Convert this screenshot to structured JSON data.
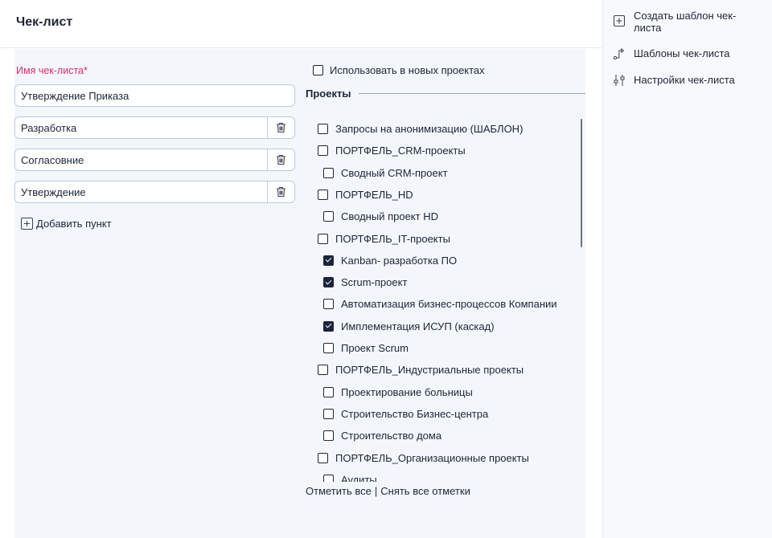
{
  "header": {
    "title": "Чек-лист"
  },
  "form": {
    "name_label": "Имя чек-листа*",
    "name_value": "Утверждение Приказа",
    "items": [
      "Разработка",
      "Согласовние",
      "Утверждение"
    ],
    "add_item_label": "Добавить пункт"
  },
  "use_in_new_projects": {
    "label": "Использовать в новых проектах",
    "checked": false
  },
  "projects": {
    "title": "Проекты",
    "items": [
      {
        "label": "Запросы на анонимизацию (ШАБЛОН)",
        "level": 0,
        "checked": false
      },
      {
        "label": "ПОРТФЕЛЬ_CRM-проекты",
        "level": 0,
        "checked": false
      },
      {
        "label": "Сводный CRM-проект",
        "level": 1,
        "checked": false
      },
      {
        "label": "ПОРТФЕЛЬ_HD",
        "level": 0,
        "checked": false
      },
      {
        "label": "Сводный проект HD",
        "level": 1,
        "checked": false
      },
      {
        "label": "ПОРТФЕЛЬ_IT-проекты",
        "level": 0,
        "checked": false
      },
      {
        "label": "Kanban- разработка ПО",
        "level": 1,
        "checked": true
      },
      {
        "label": "Scrum-проект",
        "level": 1,
        "checked": true
      },
      {
        "label": "Автоматизация бизнес-процессов Компании",
        "level": 1,
        "checked": false
      },
      {
        "label": "Имплементация ИСУП (каскад)",
        "level": 1,
        "checked": true
      },
      {
        "label": "Проект Scrum",
        "level": 1,
        "checked": false
      },
      {
        "label": "ПОРТФЕЛЬ_Индустриальные проекты",
        "level": 0,
        "checked": false
      },
      {
        "label": "Проектирование больницы",
        "level": 1,
        "checked": false
      },
      {
        "label": "Строительство Бизнес-центра",
        "level": 1,
        "checked": false
      },
      {
        "label": "Строительство дома",
        "level": 1,
        "checked": false
      },
      {
        "label": "ПОРТФЕЛЬ_Организационные проекты",
        "level": 0,
        "checked": false
      },
      {
        "label": "Аудиты",
        "level": 1,
        "checked": false
      }
    ],
    "select_all": "Отметить все",
    "separator": "|",
    "deselect_all": "Снять все отметки"
  },
  "sidebar": {
    "items": [
      {
        "label": "Создать шаблон чек-листа",
        "icon": "plus-square-icon"
      },
      {
        "label": "Шаблоны чек-листа",
        "icon": "route-icon"
      },
      {
        "label": "Настройки чек-листа",
        "icon": "sliders-icon"
      }
    ]
  },
  "colors": {
    "required_label": "#e02966",
    "checkbox_checked": "#1b2340",
    "panel_bg": "#f3f7fc",
    "input_border": "#b8ccdf"
  }
}
